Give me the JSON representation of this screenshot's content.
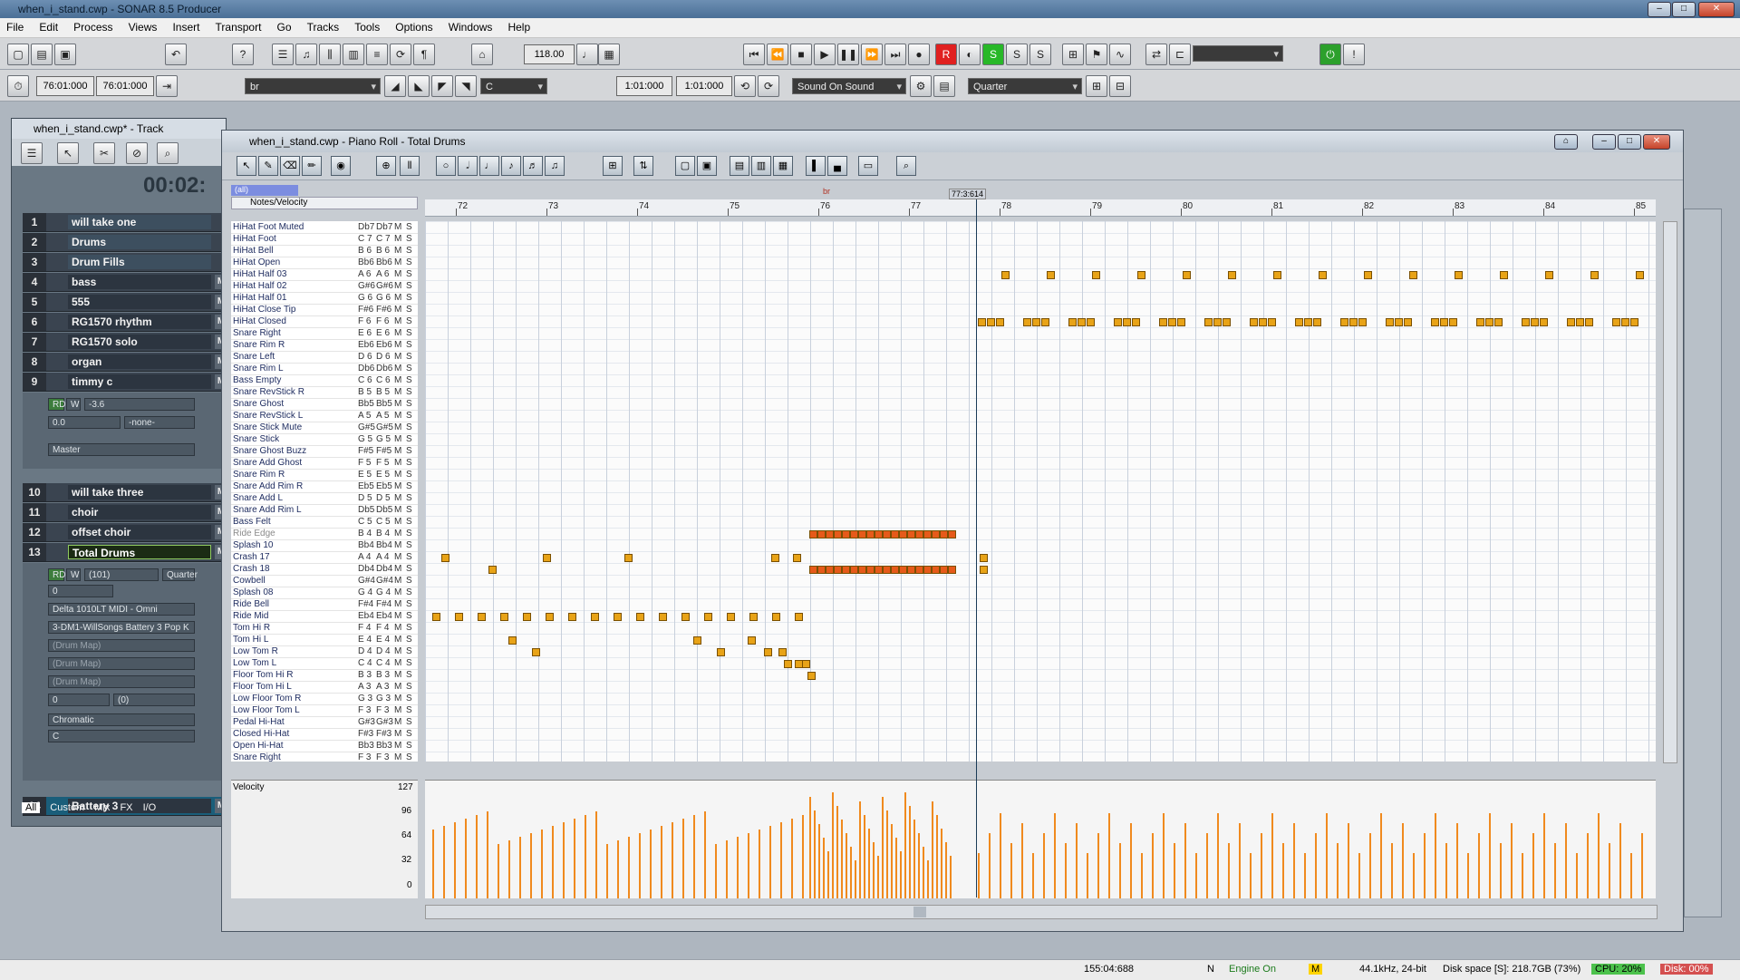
{
  "app": {
    "title": "when_i_stand.cwp - SONAR 8.5 Producer",
    "menu": [
      "File",
      "Edit",
      "Process",
      "Views",
      "Insert",
      "Transport",
      "Go",
      "Tracks",
      "Tools",
      "Options",
      "Windows",
      "Help"
    ]
  },
  "toolbar": {
    "tempo": "118.00",
    "time1": "76:01:000",
    "time2": "76:01:000",
    "marker_select": "br",
    "key_select": "C",
    "loop_start": "1:01:000",
    "loop_end": "1:01:000",
    "sound_mode": "Sound On Sound",
    "snap": "Quarter"
  },
  "track_window": {
    "title": "when_i_stand.cwp* - Track",
    "clock": "00:02:",
    "tracks": [
      {
        "num": "1",
        "name": "will take one",
        "mute": ""
      },
      {
        "num": "2",
        "name": "Drums",
        "mute": ""
      },
      {
        "num": "3",
        "name": "Drum Fills",
        "mute": ""
      },
      {
        "num": "4",
        "name": "bass",
        "mute": "M"
      },
      {
        "num": "5",
        "name": "555",
        "mute": "M"
      },
      {
        "num": "6",
        "name": "RG1570 rhythm",
        "mute": "M"
      },
      {
        "num": "7",
        "name": "RG1570 solo",
        "mute": "M"
      },
      {
        "num": "8",
        "name": "organ",
        "mute": "M"
      },
      {
        "num": "9",
        "name": "timmy c",
        "mute": "M"
      },
      {
        "num": "10",
        "name": "will take three",
        "mute": "M"
      },
      {
        "num": "11",
        "name": "choir",
        "mute": "M"
      },
      {
        "num": "12",
        "name": "offset choir",
        "mute": "M"
      },
      {
        "num": "13",
        "name": "Total Drums",
        "mute": "M"
      },
      {
        "num": "14",
        "name": "Battery 3",
        "mute": "M"
      }
    ],
    "strip9": {
      "vol": "-3.6",
      "pan": "0.0",
      "input": "-none-",
      "output": "Master"
    },
    "strip13": {
      "vol": "(101)",
      "pan": "0",
      "snap": "Quarter",
      "input": "Delta 1010LT MIDI - Omni",
      "output": "3-DM1-WillSongs Battery 3 Pop K",
      "drum1": "(Drum Map)",
      "drum2": "(Drum Map)",
      "drum3": "(Drum Map)",
      "key": "0",
      "vel": "(0)",
      "scale": "Chromatic",
      "root": "C"
    },
    "tabs": [
      "All",
      "Custom",
      "Mix",
      "FX",
      "I/O"
    ]
  },
  "piano_roll": {
    "title": "when_i_stand.cwp - Piano Roll - Total Drums",
    "track_select": "(all)",
    "controller": "Notes/Velocity",
    "marker_label": "br",
    "cursor_time": "77:3:614",
    "measures": [
      "72",
      "73",
      "74",
      "75",
      "76",
      "77",
      "78",
      "79",
      "80",
      "81",
      "82",
      "83",
      "84",
      "85"
    ],
    "keys": [
      {
        "name": "HiHat Foot Muted",
        "a": "Db7",
        "b": "Db7"
      },
      {
        "name": "HiHat Foot",
        "a": "C 7",
        "b": "C 7"
      },
      {
        "name": "HiHat Bell",
        "a": "B 6",
        "b": "B 6"
      },
      {
        "name": "HiHat Open",
        "a": "Bb6",
        "b": "Bb6"
      },
      {
        "name": "HiHat Half 03",
        "a": "A 6",
        "b": "A 6"
      },
      {
        "name": "HiHat Half 02",
        "a": "G#6",
        "b": "G#6"
      },
      {
        "name": "HiHat Half 01",
        "a": "G 6",
        "b": "G 6"
      },
      {
        "name": "HiHat Close Tip",
        "a": "F#6",
        "b": "F#6"
      },
      {
        "name": "HiHat Closed",
        "a": "F 6",
        "b": "F 6"
      },
      {
        "name": "Snare Right",
        "a": "E 6",
        "b": "E 6"
      },
      {
        "name": "Snare Rim R",
        "a": "Eb6",
        "b": "Eb6"
      },
      {
        "name": "Snare Left",
        "a": "D 6",
        "b": "D 6"
      },
      {
        "name": "Snare Rim L",
        "a": "Db6",
        "b": "Db6"
      },
      {
        "name": "Bass Empty",
        "a": "C 6",
        "b": "C 6"
      },
      {
        "name": "Snare RevStick R",
        "a": "B 5",
        "b": "B 5"
      },
      {
        "name": "Snare Ghost",
        "a": "Bb5",
        "b": "Bb5"
      },
      {
        "name": "Snare RevStick L",
        "a": "A 5",
        "b": "A 5"
      },
      {
        "name": "Snare Stick Mute",
        "a": "G#5",
        "b": "G#5"
      },
      {
        "name": "Snare Stick",
        "a": "G 5",
        "b": "G 5"
      },
      {
        "name": "Snare Ghost Buzz",
        "a": "F#5",
        "b": "F#5"
      },
      {
        "name": "Snare Add Ghost",
        "a": "F 5",
        "b": "F 5"
      },
      {
        "name": "Snare Rim R",
        "a": "E 5",
        "b": "E 5"
      },
      {
        "name": "Snare Add Rim R",
        "a": "Eb5",
        "b": "Eb5"
      },
      {
        "name": "Snare Add L",
        "a": "D 5",
        "b": "D 5"
      },
      {
        "name": "Snare Add Rim L",
        "a": "Db5",
        "b": "Db5"
      },
      {
        "name": "Bass Felt",
        "a": "C 5",
        "b": "C 5"
      },
      {
        "name": "Ride Edge",
        "a": "B 4",
        "b": "B 4"
      },
      {
        "name": "Splash 10",
        "a": "Bb4",
        "b": "Bb4"
      },
      {
        "name": "Crash 17",
        "a": "A 4",
        "b": "A 4"
      },
      {
        "name": "Crash 18",
        "a": "Db4",
        "b": "Db4"
      },
      {
        "name": "Cowbell",
        "a": "G#4",
        "b": "G#4"
      },
      {
        "name": "Splash 08",
        "a": "G 4",
        "b": "G 4"
      },
      {
        "name": "Ride Bell",
        "a": "F#4",
        "b": "F#4"
      },
      {
        "name": "Ride Mid",
        "a": "Eb4",
        "b": "Eb4"
      },
      {
        "name": "Tom Hi R",
        "a": "F 4",
        "b": "F 4"
      },
      {
        "name": "Tom Hi L",
        "a": "E 4",
        "b": "E 4"
      },
      {
        "name": "Low Tom R",
        "a": "D 4",
        "b": "D 4"
      },
      {
        "name": "Low Tom L",
        "a": "C 4",
        "b": "C 4"
      },
      {
        "name": "Floor Tom Hi R",
        "a": "B 3",
        "b": "B 3"
      },
      {
        "name": "Floor Tom Hi L",
        "a": "A 3",
        "b": "A 3"
      },
      {
        "name": "Low Floor Tom R",
        "a": "G 3",
        "b": "G 3"
      },
      {
        "name": "Low Floor Tom L",
        "a": "F 3",
        "b": "F 3"
      },
      {
        "name": "Pedal Hi-Hat",
        "a": "G#3",
        "b": "G#3"
      },
      {
        "name": "Closed Hi-Hat",
        "a": "F#3",
        "b": "F#3"
      },
      {
        "name": "Open Hi-Hat",
        "a": "Bb3",
        "b": "Bb3"
      },
      {
        "name": "Snare Right",
        "a": "F 3",
        "b": "F 3"
      }
    ],
    "key_m": "M",
    "key_s": "S",
    "velocity_label": "Velocity",
    "velocity_ticks": [
      "127",
      "96",
      "64",
      "32",
      "0"
    ]
  },
  "status": {
    "time": "155:04:688",
    "n": "N",
    "engine": "Engine On",
    "m": "M",
    "rate": "44.1kHz, 24-bit",
    "disk_space": "Disk space [S]: 218.7GB (73%)",
    "cpu": "CPU: 20%",
    "disk": "Disk: 00%"
  }
}
